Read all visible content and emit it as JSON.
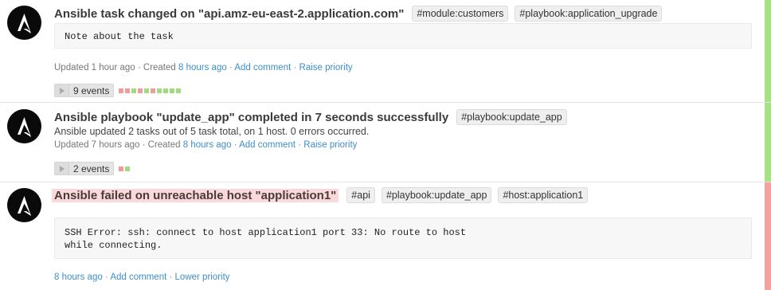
{
  "colors": {
    "success": "#a6e185",
    "error": "#f4a1a1",
    "dot_green": "#9fdd7c",
    "dot_red": "#f09a9a",
    "link": "#3d8ec9"
  },
  "events": [
    {
      "icon": "ansible-logo-icon",
      "status": "success",
      "title": "Ansible task changed on \"api.amz-eu-east-2.application.com\"",
      "tags": [
        "#module:customers",
        "#playbook:application_upgrade"
      ],
      "note_lines": [
        "Note about the task"
      ],
      "meta": {
        "updated_text": "Updated 1 hour ago · Created",
        "created_link": "8 hours ago",
        "sep1": " · ",
        "add_comment": "Add comment",
        "sep2": " · ",
        "priority": "Raise priority"
      },
      "events_count_label": "9 events",
      "event_dots": [
        "red",
        "red",
        "green",
        "red",
        "green",
        "red",
        "green",
        "green",
        "green",
        "green"
      ]
    },
    {
      "icon": "ansible-logo-icon",
      "status": "success",
      "title": "Ansible playbook \"update_app\" completed in 7 seconds successfully",
      "tags": [
        "#playbook:update_app"
      ],
      "body": "Ansible updated 2 tasks out of 5 task total, on 1 host. 0 errors occurred.",
      "meta": {
        "updated_text": "Updated 7 hours ago · Created",
        "created_link": "8 hours ago",
        "sep1": " · ",
        "add_comment": "Add comment",
        "sep2": " · ",
        "priority": "Raise priority"
      },
      "events_count_label": "2 events",
      "event_dots": [
        "red",
        "green"
      ]
    },
    {
      "icon": "ansible-logo-icon",
      "status": "error",
      "title": "Ansible failed on unreachable host \"application1\"",
      "tags": [
        "#api",
        "#playbook:update_app",
        "#host:application1"
      ],
      "note_lines": [
        "SSH Error: ssh: connect to host application1 port 33: No route to host",
        "while connecting."
      ],
      "meta": {
        "created_link": "8 hours ago",
        "sep1": " · ",
        "add_comment": "Add comment",
        "sep2": " · ",
        "priority": "Lower priority"
      }
    }
  ]
}
